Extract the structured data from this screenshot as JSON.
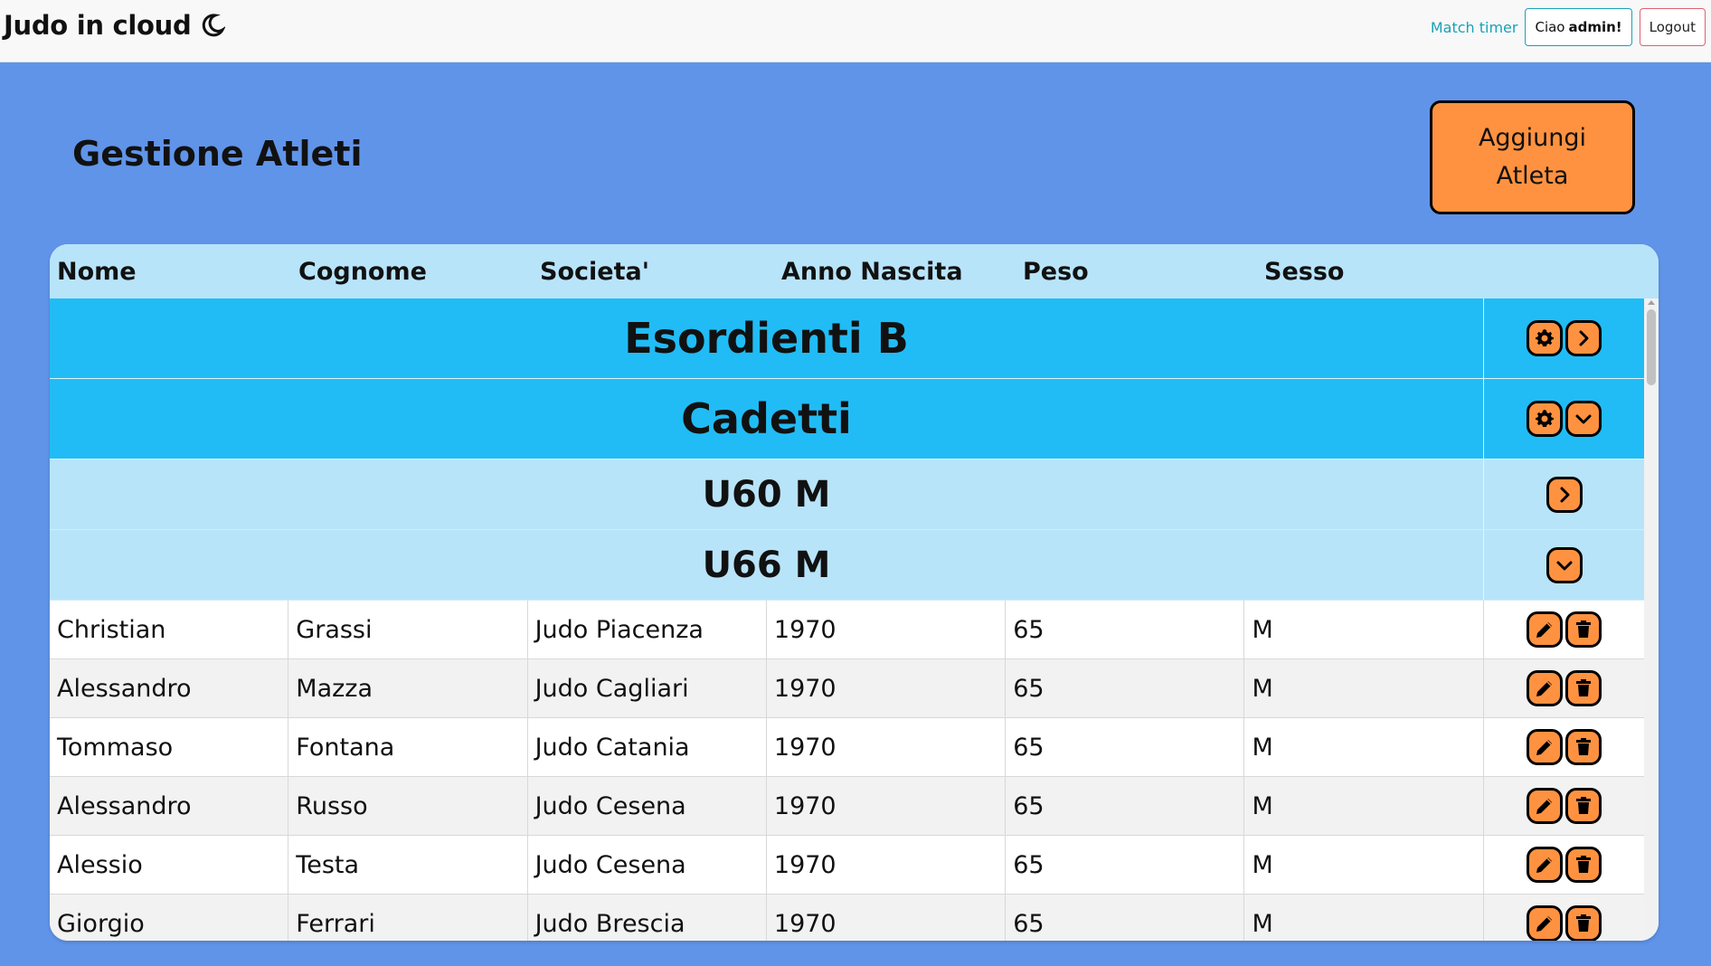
{
  "app": {
    "brand": "Judo in cloud"
  },
  "nav": {
    "match_timer": "Match timer",
    "greeting": "Ciao",
    "username": "admin!",
    "logout": "Logout"
  },
  "page": {
    "title": "Gestione Atleti",
    "add_button": "Aggiungi Atleta"
  },
  "table": {
    "headers": [
      "Nome",
      "Cognome",
      "Societa'",
      "Anno Nascita",
      "Peso",
      "Sesso"
    ],
    "groups": [
      "Esordienti B",
      "Cadetti"
    ],
    "subgroups": [
      "U60 M",
      "U66 M"
    ],
    "rows": [
      [
        "Christian",
        "Grassi",
        "Judo Piacenza",
        "1970",
        "65",
        "M"
      ],
      [
        "Alessandro",
        "Mazza",
        "Judo Cagliari",
        "1970",
        "65",
        "M"
      ],
      [
        "Tommaso",
        "Fontana",
        "Judo Catania",
        "1970",
        "65",
        "M"
      ],
      [
        "Alessandro",
        "Russo",
        "Judo Cesena",
        "1970",
        "65",
        "M"
      ],
      [
        "Alessio",
        "Testa",
        "Judo Cesena",
        "1970",
        "65",
        "M"
      ],
      [
        "Giorgio",
        "Ferrari",
        "Judo Brescia",
        "1970",
        "65",
        "M"
      ]
    ]
  },
  "colors": {
    "background": "#6094e9",
    "accent": "#ff9240",
    "group_row": "#21bcf5",
    "subgroup_row": "#b8e4fa"
  }
}
